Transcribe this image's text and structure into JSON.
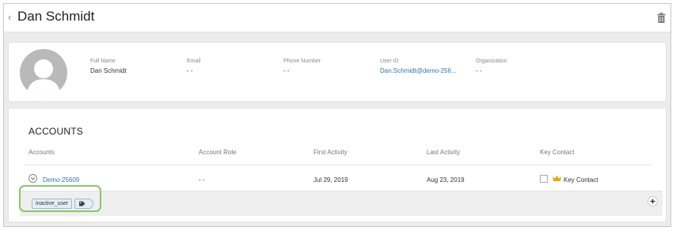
{
  "header": {
    "title": "Dan Schmidt"
  },
  "profile": {
    "fields": [
      {
        "label": "Full Name",
        "value": "Dan Schmidt"
      },
      {
        "label": "Email",
        "value": "- -"
      },
      {
        "label": "Phone Number",
        "value": "- -"
      },
      {
        "label": "User ID",
        "value": "Dan.Schmidt@demo-256..."
      },
      {
        "label": "Organization",
        "value": "- -"
      }
    ]
  },
  "accounts": {
    "title": "ACCOUNTS",
    "columns": [
      "Accounts",
      "Account Role",
      "First Activity",
      "Last Activity",
      "Key Contact"
    ],
    "row": {
      "account": "Demo-25609",
      "role": "- -",
      "first_activity": "Jul 29, 2019",
      "last_activity": "Aug 23, 2019",
      "key_contact_label": "Key Contact"
    },
    "tag": "inactive_user"
  },
  "icons": [
    "back-chevron-icon",
    "trash-icon",
    "avatar-placeholder",
    "expand-chevron-icon",
    "crown-icon",
    "tag-icon",
    "plus-icon"
  ],
  "colors": {
    "link": "#2f74b5",
    "crown": "#e8a722",
    "highlight": "#8cc56a",
    "tag_bg": "#e4eef6"
  }
}
